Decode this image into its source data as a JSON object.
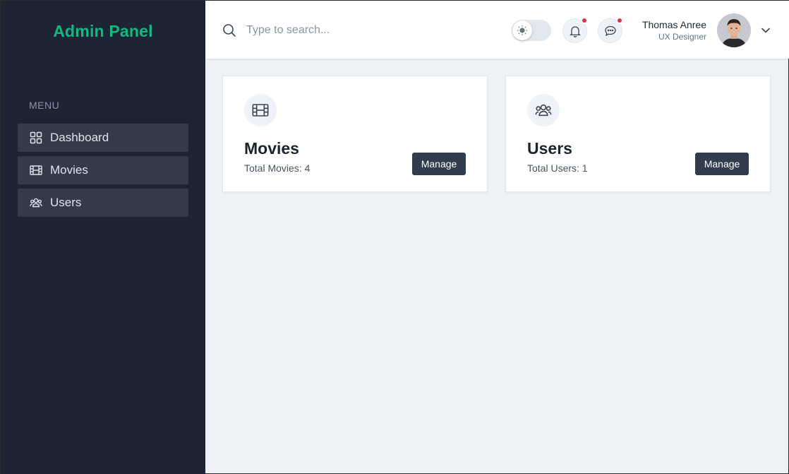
{
  "sidebar": {
    "brand": "Admin Panel",
    "menu_label": "MENU",
    "items": [
      {
        "label": "Dashboard",
        "icon": "grid-icon"
      },
      {
        "label": "Movies",
        "icon": "film-icon"
      },
      {
        "label": "Users",
        "icon": "users-icon"
      }
    ]
  },
  "header": {
    "search_placeholder": "Type to search...",
    "user_name": "Thomas Anree",
    "user_role": "UX Designer"
  },
  "cards": [
    {
      "title": "Movies",
      "subtitle": "Total Movies: 4",
      "button": "Manage",
      "icon": "film-icon"
    },
    {
      "title": "Users",
      "subtitle": "Total Users: 1",
      "button": "Manage",
      "icon": "users-icon"
    }
  ],
  "colors": {
    "sidebar_bg": "#1d2434",
    "brand": "#10b981",
    "nav_item_bg": "#333a48",
    "content_bg": "#eef2f7",
    "button_bg": "#313c4c",
    "notification_dot": "#dc3545"
  }
}
